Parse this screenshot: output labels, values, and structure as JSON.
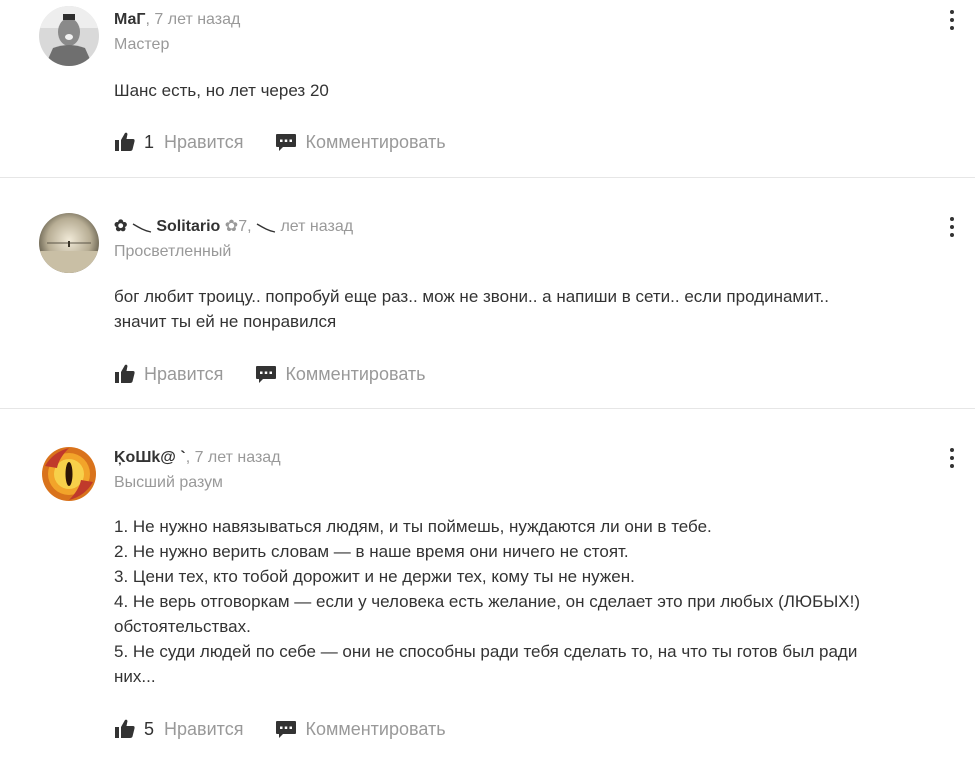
{
  "answers": [
    {
      "author": "МаГ",
      "time": ", 7 лет назад",
      "rank": "Мастер",
      "text": "Шанс есть, но лет через 20",
      "likes": "1",
      "like_label": "Нравится",
      "comment_label": "Комментировать"
    },
    {
      "author_prefix": "✿",
      "author": "Solitario",
      "author_suffix": "✿7",
      "time": " лет назад",
      "rank": "Просветленный",
      "text": "бог любит троицу.. попробуй еще раз.. мож не звони.. а напиши в сети.. если продинамит..\nзначит ты ей не понравился",
      "likes": "",
      "like_label": "Нравится",
      "comment_label": "Комментировать"
    },
    {
      "author": "ĶoШk@ `",
      "time": ", 7 лет назад",
      "rank": "Высший разум",
      "text": "1. Не нужно навязываться людям, и ты поймешь, нуждаются ли они в тебе.\n2. Не нужно верить словам — в наше время они ничего не стоят.\n3. Цени тех, кто тобой дорожит и не держи тех, кому ты не нужен.\n4. Не верь отговоркам — если у человека есть желание, он сделает это при любых (ЛЮБЫХ!)\nобстоятельствах.\n5. Не суди людей по себе — они не способны ради тебя сделать то, на что ты готов был ради\nних...",
      "likes": "5",
      "like_label": "Нравится",
      "comment_label": "Комментировать"
    }
  ],
  "icons": {
    "like": "thumbs-up-icon",
    "comment": "comment-icon",
    "more": "more-vertical-icon"
  },
  "colors": {
    "text": "#333333",
    "muted": "#999999",
    "divider": "#e6e6e6"
  }
}
